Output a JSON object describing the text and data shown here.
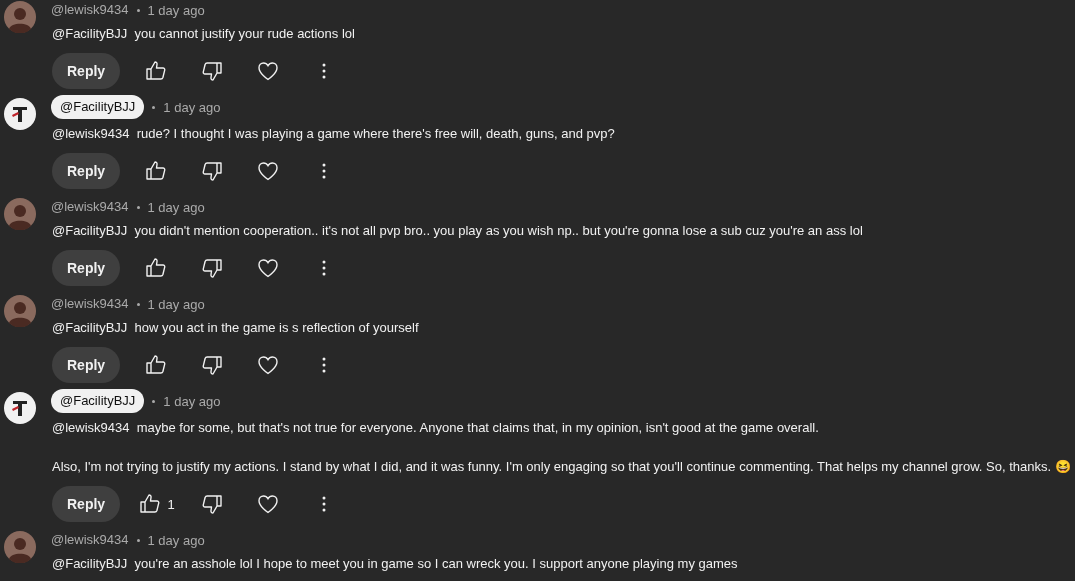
{
  "comments": [
    {
      "author": "@lewisk9434",
      "kind": "viewer",
      "time": "1 day ago",
      "paragraphs": [
        "@FacilityBJJ  you cannot justify your rude actions lol"
      ],
      "reply": "Reply"
    },
    {
      "author": "@FacilityBJJ",
      "kind": "owner",
      "time": "1 day ago",
      "paragraphs": [
        "@lewisk9434  rude? I thought I was playing a game where there's free will, death, guns, and pvp?"
      ],
      "reply": "Reply"
    },
    {
      "author": "@lewisk9434",
      "kind": "viewer",
      "time": "1 day ago",
      "paragraphs": [
        "@FacilityBJJ  you didn't mention cooperation.. it's not all pvp bro.. you play as you wish np.. but you're gonna lose a sub cuz you're an ass lol"
      ],
      "reply": "Reply"
    },
    {
      "author": "@lewisk9434",
      "kind": "viewer",
      "time": "1 day ago",
      "paragraphs": [
        "@FacilityBJJ  how you act in the game is s reflection of yourself"
      ],
      "reply": "Reply"
    },
    {
      "author": "@FacilityBJJ",
      "kind": "owner",
      "time": "1 day ago",
      "paragraphs": [
        "@lewisk9434  maybe for some, but that's not true for everyone. Anyone that claims that, in my opinion, isn't good at the game overall.",
        "Also, I'm not trying to justify my actions. I stand by what I did, and it was funny. I'm only engaging so that you'll continue commenting. That helps my channel grow. So, thanks. 😆"
      ],
      "reply": "Reply",
      "likes": "1"
    },
    {
      "author": "@lewisk9434",
      "kind": "viewer",
      "time": "1 day ago",
      "paragraphs": [
        "@FacilityBJJ  you're an asshole lol I hope to meet you in game so I can wreck you. I support anyone playing my games"
      ]
    }
  ]
}
